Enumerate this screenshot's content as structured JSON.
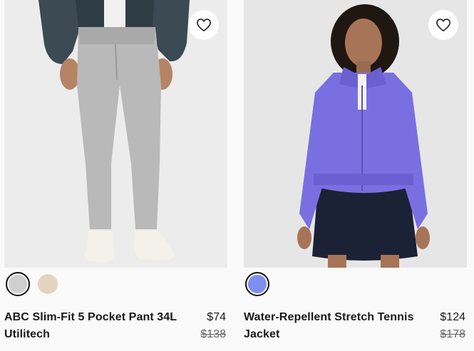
{
  "products": [
    {
      "name": "ABC Slim-Fit 5 Pocket Pant 34L Utilitech",
      "price": "$74",
      "original_price": "$138",
      "swatch_colors": [
        "#cfcfcf",
        "#e3d4bd"
      ],
      "selected_swatch": 0
    },
    {
      "name": "Water-Repellent Stretch Tennis Jacket",
      "price": "$124",
      "original_price": "$178",
      "swatch_colors": [
        "#7f8ff0"
      ],
      "selected_swatch": 0
    }
  ],
  "icons": {
    "wishlist": "heart-outline-icon"
  }
}
